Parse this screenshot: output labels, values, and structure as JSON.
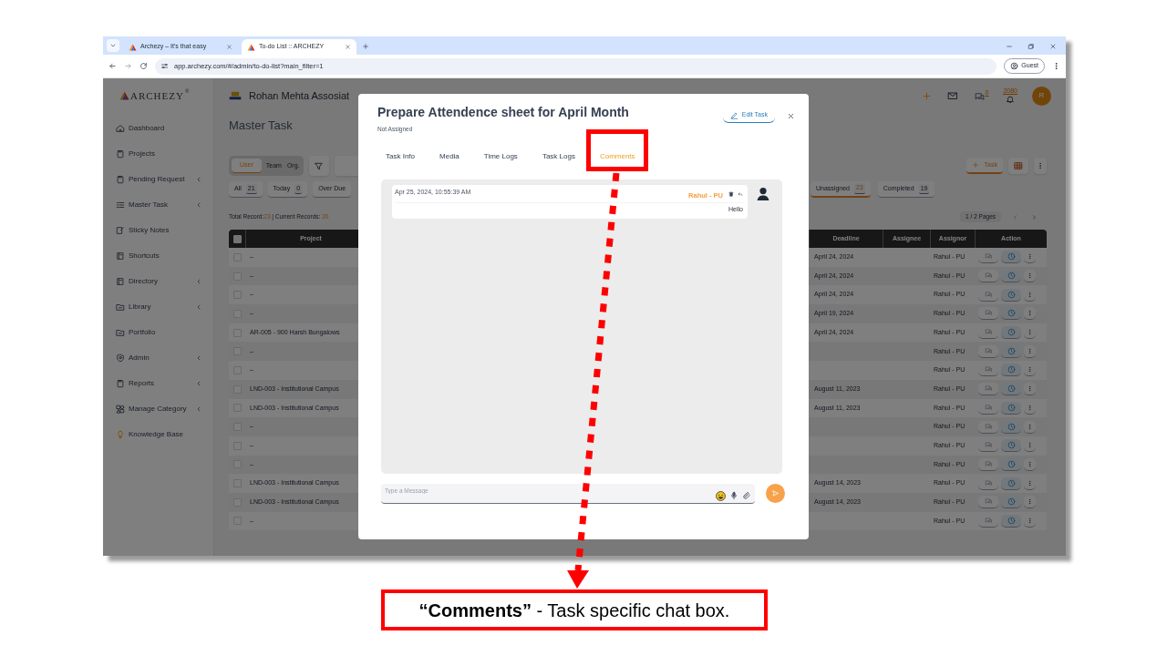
{
  "browser": {
    "tabs": [
      {
        "title": "Archezy – It's that easy",
        "selected": false
      },
      {
        "title": "To-do List :: ARCHEZY",
        "selected": true
      }
    ],
    "address": "app.archezy.com/#/admin/to-do-list?main_filter=1",
    "profile": "Guest"
  },
  "app": {
    "brand": "ARCHEZY",
    "brand_mark": "®",
    "org": "Rohan Mehta Assosiat",
    "chat_count": "0",
    "notification_count": "2080",
    "avatar": "R"
  },
  "sidebar": {
    "items": [
      {
        "label": "Dashboard",
        "expandable": false
      },
      {
        "label": "Projects",
        "expandable": false
      },
      {
        "label": "Pending Request",
        "expandable": true
      },
      {
        "label": "Master Task",
        "expandable": true
      },
      {
        "label": "Sticky Notes",
        "expandable": false
      },
      {
        "label": "Shortcuts",
        "expandable": false
      },
      {
        "label": "Directory",
        "expandable": true
      },
      {
        "label": "Library",
        "expandable": true
      },
      {
        "label": "Portfolio",
        "expandable": false
      },
      {
        "label": "Admin",
        "expandable": true
      },
      {
        "label": "Reports",
        "expandable": true
      },
      {
        "label": "Manage Category",
        "expandable": true
      },
      {
        "label": "Knowledge Base",
        "expandable": false
      }
    ]
  },
  "page": {
    "title": "Master Task",
    "scope_tabs": [
      {
        "label": "User",
        "selected": true
      },
      {
        "label": "Team",
        "selected": false
      },
      {
        "label": "Org.",
        "selected": false
      }
    ],
    "add_button": "Task",
    "filters": [
      {
        "label": "All",
        "count": "21",
        "selected": false
      },
      {
        "label": "Today",
        "count": "0",
        "selected": false
      },
      {
        "label": "Over Due",
        "selected": false
      },
      {
        "label": "Unassigned",
        "count": "23",
        "selected": true
      },
      {
        "label": "Completed",
        "count": "19",
        "selected": false
      }
    ],
    "records": {
      "total_label": "Total Record:",
      "total": "23",
      "current_label": "| Current Records:",
      "current": "20"
    },
    "pages": "1 / 2 Pages",
    "table": {
      "all_checked": false,
      "columns": [
        "Project",
        "Deadline",
        "Assignee",
        "Assignor",
        "Action"
      ],
      "rows": [
        {
          "project": "–",
          "deadline": "April 24, 2024",
          "assignor": "Rahul - PU",
          "checked": false
        },
        {
          "project": "–",
          "deadline": "April 24, 2024",
          "assignor": "Rahul - PU",
          "checked": false
        },
        {
          "project": "–",
          "deadline": "April 24, 2024",
          "assignor": "Rahul - PU",
          "checked": false
        },
        {
          "project": "–",
          "deadline": "April 19, 2024",
          "assignor": "Rahul - PU",
          "checked": false
        },
        {
          "project": "AR-005 - 900 Harsh Bungalows",
          "deadline": "April 24, 2024",
          "assignor": "Rahul - PU",
          "checked": false
        },
        {
          "project": "–",
          "assignor": "Rahul - PU",
          "checked": false
        },
        {
          "project": "–",
          "assignor": "Rahul - PU",
          "checked": false
        },
        {
          "project": "LND-003 - Institutional Campus",
          "deadline": "August 11, 2023",
          "assignor": "Rahul - PU",
          "checked": false
        },
        {
          "project": "LND-003 - Institutional Campus",
          "deadline": "August 11, 2023",
          "assignor": "Rahul - PU",
          "checked": false
        },
        {
          "project": "–",
          "assignor": "Rahul - PU",
          "checked": false
        },
        {
          "project": "–",
          "assignor": "Rahul - PU",
          "checked": false
        },
        {
          "project": "–",
          "assignor": "Rahul - PU",
          "checked": false
        },
        {
          "project": "LND-003 - Institutional Campus",
          "deadline": "August 14, 2023",
          "assignor": "Rahul - PU",
          "checked": false
        },
        {
          "project": "LND-003 - Institutional Campus",
          "deadline": "August 14, 2023",
          "assignor": "Rahul - PU",
          "checked": false
        },
        {
          "project": "–",
          "assignor": "Rahul - PU",
          "checked": false
        }
      ]
    }
  },
  "modal": {
    "title": "Prepare Attendence sheet for April Month",
    "subtitle": "Not Assigned",
    "edit_button": "Edit Task",
    "tabs": [
      {
        "label": "Task Info",
        "selected": false
      },
      {
        "label": "Media",
        "selected": false
      },
      {
        "label": "Time Logs",
        "selected": false
      },
      {
        "label": "Task Logs",
        "selected": false
      },
      {
        "label": "Comments",
        "selected": true
      }
    ],
    "comments": [
      {
        "time": "Apr 25, 2024, 10:55:39 AM",
        "author": "Rahul - PU",
        "text": "Hello"
      }
    ],
    "message_input": {
      "placeholder": "Type a Message"
    }
  },
  "callout": {
    "caption": "**“Comments”** - Task specific chat box."
  }
}
